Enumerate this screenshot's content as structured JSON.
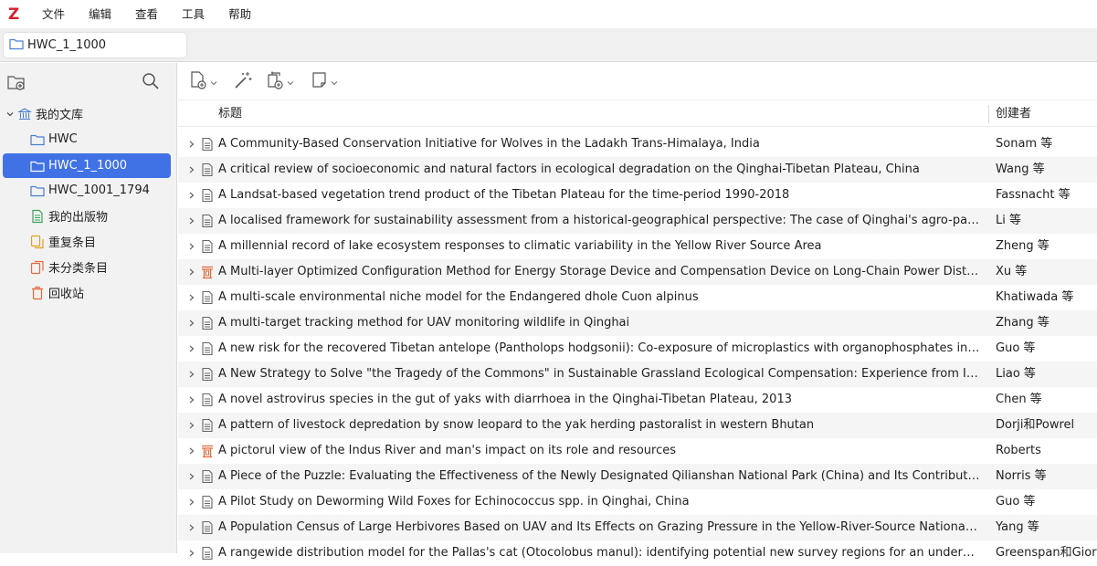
{
  "app": {
    "logo": "Z"
  },
  "menu": [
    "文件",
    "编辑",
    "查看",
    "工具",
    "帮助"
  ],
  "tab": {
    "label": "HWC_1_1000",
    "icon": "folder-icon"
  },
  "sidebar": {
    "toolbar": {
      "new_collection_icon": "new-collection-icon",
      "search_icon": "search-icon"
    },
    "items": [
      {
        "label": "我的文库",
        "icon": "library-icon",
        "level": 0,
        "expanded": true,
        "selected": false
      },
      {
        "label": "HWC",
        "icon": "folder-icon",
        "level": 1,
        "selected": false
      },
      {
        "label": "HWC_1_1000",
        "icon": "folder-icon",
        "level": 1,
        "selected": true
      },
      {
        "label": "HWC_1001_1794",
        "icon": "folder-icon",
        "level": 1,
        "selected": false
      },
      {
        "label": "我的出版物",
        "icon": "publications-icon",
        "level": 1,
        "selected": false
      },
      {
        "label": "重复条目",
        "icon": "duplicates-icon",
        "level": 1,
        "selected": false
      },
      {
        "label": "未分类条目",
        "icon": "unfiled-icon",
        "level": 1,
        "selected": false
      },
      {
        "label": "回收站",
        "icon": "trash-icon",
        "level": 1,
        "selected": false
      }
    ]
  },
  "toolbar": {
    "buttons": [
      "new-item-icon",
      "magic-wand-icon",
      "add-attachment-icon",
      "new-note-icon"
    ]
  },
  "columns": {
    "title": "标题",
    "creator": "创建者"
  },
  "rows": [
    {
      "title": "A Community-Based Conservation Initiative for Wolves in the Ladakh Trans-Himalaya, India",
      "creator": "Sonam 等",
      "type": "document"
    },
    {
      "title": "A critical review of socioeconomic and natural factors in ecological degradation on the Qinghai-Tibetan Plateau, China",
      "creator": "Wang 等",
      "type": "document"
    },
    {
      "title": "A Landsat-based vegetation trend product of the Tibetan Plateau for the time-period 1990-2018",
      "creator": "Fassnacht 等",
      "type": "document"
    },
    {
      "title": "A localised framework for sustainability assessment from a historical-geographical perspective: The case of Qinghai's agro-pastoral c...",
      "creator": "Li 等",
      "type": "document"
    },
    {
      "title": "A millennial record of lake ecosystem responses to climatic variability in the Yellow River Source Area",
      "creator": "Zheng 等",
      "type": "document"
    },
    {
      "title": "A Multi-layer Optimized Configuration Method for Energy Storage Device and Compensation Device on Long-Chain Power Distribut...",
      "creator": "Xu 等",
      "type": "thesis"
    },
    {
      "title": "A multi-scale environmental niche model for the Endangered dhole Cuon alpinus",
      "creator": "Khatiwada 等",
      "type": "document"
    },
    {
      "title": "A multi-target tracking method for UAV monitoring wildlife in Qinghai",
      "creator": "Zhang 等",
      "type": "document"
    },
    {
      "title": "A new risk for the recovered Tibetan antelope (Pantholops hodgsonii): Co-exposure of microplastics with organophosphates in their ...",
      "creator": "Guo 等",
      "type": "document"
    },
    {
      "title": "A New Strategy to Solve \"the Tragedy of the Commons\" in Sustainable Grassland Ecological Compensation: Experience from Inner M...",
      "creator": "Liao 等",
      "type": "document"
    },
    {
      "title": "A novel astrovirus species in the gut of yaks with diarrhoea in the Qinghai-Tibetan Plateau, 2013",
      "creator": "Chen 等",
      "type": "document"
    },
    {
      "title": "A pattern of livestock depredation by snow leopard to the yak herding pastoralist in western Bhutan",
      "creator": "Dorji和Powrel",
      "type": "document"
    },
    {
      "title": "A pictorul view of the Indus River and man's impact on its role and resources",
      "creator": "Roberts",
      "type": "thesis"
    },
    {
      "title": "A Piece of the Puzzle: Evaluating the Effectiveness of the Newly Designated Qilianshan National Park (China) and Its Contribution to ...",
      "creator": "Norris 等",
      "type": "document"
    },
    {
      "title": "A Pilot Study on Deworming Wild Foxes for Echinococcus spp. in Qinghai, China",
      "creator": "Guo 等",
      "type": "document"
    },
    {
      "title": "A Population Census of Large Herbivores Based on UAV and Its Effects on Grazing Pressure in the Yellow-River-Source National Park,...",
      "creator": "Yang 等",
      "type": "document"
    },
    {
      "title": "A rangewide distribution model for the Pallas's cat (Otocolobus manul): identifying potential new survey regions for an understudie...",
      "creator": "Greenspan和Giord",
      "type": "document"
    }
  ],
  "colors": {
    "accent": "#4072e5",
    "logo": "#d3202e",
    "folder": "#4a7fd0",
    "publications": "#3aa45a",
    "duplicates": "#e0a020",
    "unfiled": "#e36a3a",
    "trash": "#e36a3a",
    "thesis": "#e36a3a"
  }
}
